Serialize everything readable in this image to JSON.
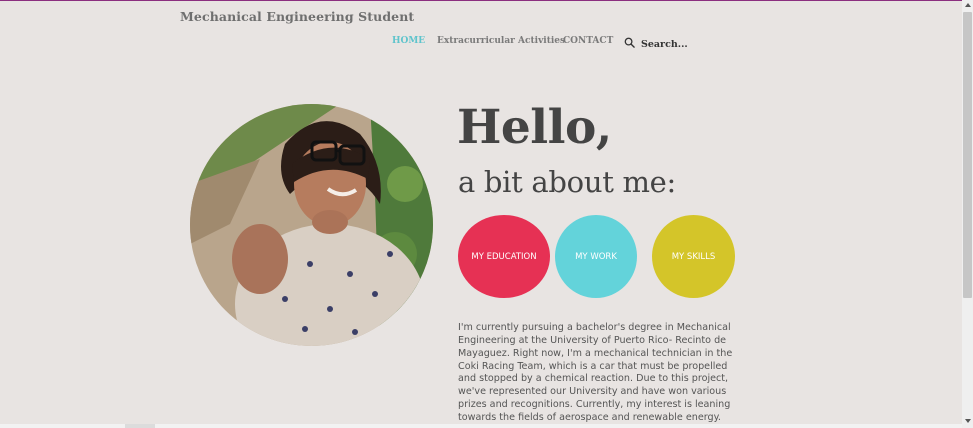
{
  "header": {
    "site_title": "Mechanical Engineering Student"
  },
  "nav": {
    "items": [
      {
        "label": "HOME",
        "active": true
      },
      {
        "label": "Extracurricular Activities",
        "active": false
      },
      {
        "label": "CONTACT",
        "active": false
      }
    ],
    "search": {
      "icon": "search-icon",
      "label": "Search..."
    }
  },
  "hero": {
    "greeting": "Hello,",
    "subtitle": "a bit about me:",
    "buttons": [
      {
        "label": "MY EDUCATION",
        "color": "#e63154"
      },
      {
        "label": "MY WORK",
        "color": "#63d3da"
      },
      {
        "label": "MY SKILLS",
        "color": "#d4c529"
      }
    ]
  },
  "bio": {
    "text": "I'm currently pursuing a bachelor's degree in Mechanical Engineering at the University of Puerto Rico- Recinto de Mayaguez. Right now, I'm a mechanical technician in the Coki Racing Team, which is a car that must be propelled and stopped by a chemical reaction. Due to this project, we've represented our University and have won various prizes and recognitions. Currently, my interest is leaning towards the fields of aerospace and renewable energy. My plans are to"
  },
  "colors": {
    "background": "#e8e4e2",
    "nav_active": "#5fc4cc",
    "top_accent": "#8b2f7f"
  }
}
